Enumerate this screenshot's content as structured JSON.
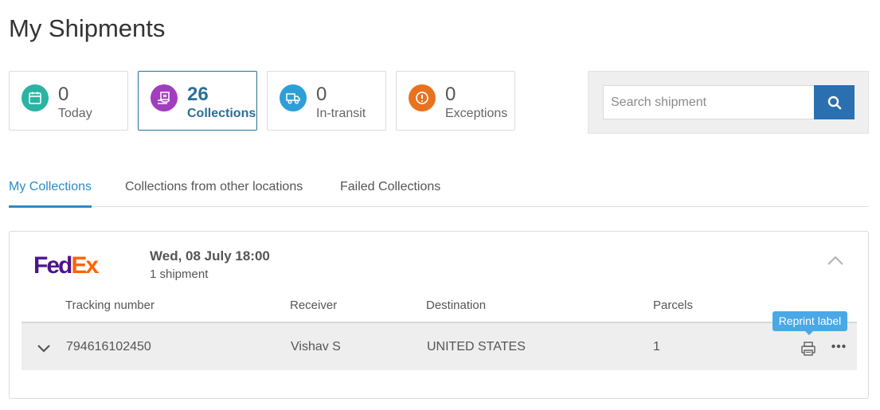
{
  "page": {
    "title": "My Shipments"
  },
  "stats": [
    {
      "count": "0",
      "label": "Today",
      "icon": "calendar-icon",
      "color": "#2bb3a3"
    },
    {
      "count": "26",
      "label": "Collections",
      "icon": "parcel-pickup-icon",
      "color": "#a03ebf"
    },
    {
      "count": "0",
      "label": "In-transit",
      "icon": "truck-icon",
      "color": "#2d9fd6"
    },
    {
      "count": "0",
      "label": "Exceptions",
      "icon": "alert-icon",
      "color": "#e8721f"
    }
  ],
  "search": {
    "placeholder": "Search shipment",
    "value": "",
    "button_color": "#2a70b0"
  },
  "tabs": [
    {
      "label": "My Collections",
      "active": true
    },
    {
      "label": "Collections from other locations",
      "active": false
    },
    {
      "label": "Failed Collections",
      "active": false
    }
  ],
  "collection": {
    "carrier_logo": {
      "fed": "Fed",
      "ex": "Ex",
      "dot": "."
    },
    "date": "Wed, 08 July 18:00",
    "shipment_count": "1 shipment",
    "columns": [
      "Tracking number",
      "Receiver",
      "Destination",
      "Parcels"
    ],
    "rows": [
      {
        "tracking": "794616102450",
        "receiver": "Vishav S",
        "destination": "UNITED STATES",
        "parcels": "1"
      }
    ],
    "tooltip": "Reprint label"
  },
  "colors": {
    "accent": "#2a8cc4",
    "active_card_border": "#2a6f97",
    "tooltip": "#49a8e6",
    "fedex_purple": "#4d148c",
    "fedex_orange": "#ff6200"
  }
}
